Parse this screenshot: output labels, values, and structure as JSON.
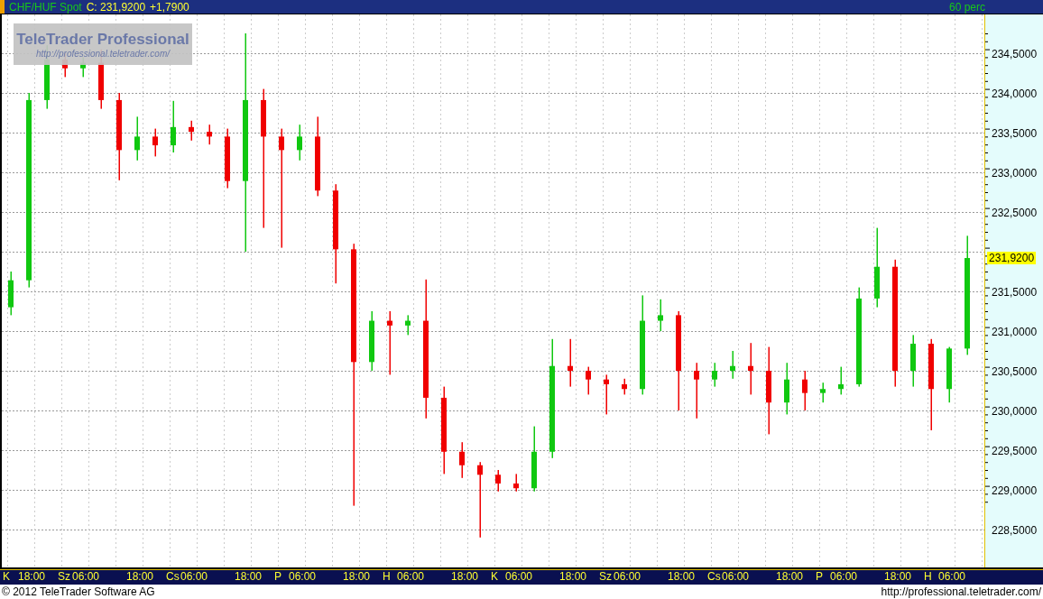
{
  "header": {
    "symbol": "CHF/HUF Spot",
    "close": "C: 231,9200",
    "change": "+1,7900",
    "interval": "60 perc"
  },
  "logo": {
    "title": "TeleTrader Professional",
    "url": "http://professional.teletrader.com/"
  },
  "chart": {
    "y_labels_upper": [
      "234,5000",
      "234,0000",
      "233,5000",
      "233,0000",
      "232,5000"
    ],
    "y_labels_lower": [
      "231,5000",
      "231,0000",
      "230,5000",
      "230,0000",
      "229,5000",
      "229,0000",
      "228,5000"
    ],
    "last_price": "231,9200",
    "x_labels": [
      "K",
      "18:00",
      "Sz",
      "06:00",
      "18:00",
      "Cs",
      "06:00",
      "18:00",
      "P",
      "06:00",
      "18:00",
      "H",
      "06:00",
      "18:00",
      "K",
      "06:00",
      "18:00",
      "Sz",
      "06:00",
      "18:00",
      "Cs",
      "06:00",
      "18:00",
      "P",
      "06:00",
      "18:00",
      "H",
      "06:00"
    ]
  },
  "footer": {
    "copyright": "© 2012 TeleTrader Software AG",
    "url": "http://professional.teletrader.com/"
  }
}
